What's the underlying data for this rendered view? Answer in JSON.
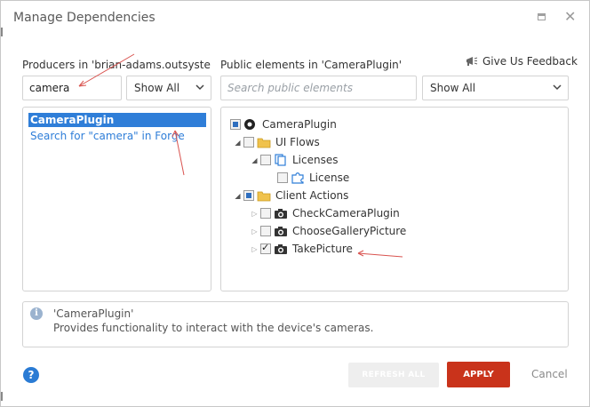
{
  "dialog": {
    "title": "Manage Dependencies",
    "window_controls": [
      "maximize-icon",
      "close-icon"
    ]
  },
  "producers": {
    "label": "Producers in 'brian-adams.outsystem...",
    "search_value": "camera",
    "filter": "Show All",
    "items": [
      {
        "label": "CameraPlugin",
        "selected": true
      },
      {
        "label": "Search for \"camera\" in Forge",
        "link": true
      }
    ]
  },
  "public_elements": {
    "label": "Public elements in 'CameraPlugin'",
    "search_placeholder": "Search public elements",
    "filter": "Show All",
    "feedback_label": "Give Us Feedback",
    "tree": {
      "root": {
        "label": "CameraPlugin",
        "check": "partial",
        "icon": "radio-module-icon"
      },
      "ui_flows": {
        "label": "UI Flows",
        "check": "none",
        "icon": "folder-icon",
        "expanded": true
      },
      "licenses": {
        "label": "Licenses",
        "check": "none",
        "icon": "pages-icon",
        "expanded": true
      },
      "license": {
        "label": "License",
        "check": "none",
        "icon": "puzzle-icon"
      },
      "client_actions": {
        "label": "Client Actions",
        "check": "partial",
        "icon": "folder-icon",
        "expanded": true
      },
      "check_camera": {
        "label": "CheckCameraPlugin",
        "check": "none",
        "icon": "camera-icon",
        "expanded": false
      },
      "choose_gallery": {
        "label": "ChooseGalleryPicture",
        "check": "none",
        "icon": "camera-icon",
        "expanded": false
      },
      "take_picture": {
        "label": "TakePicture",
        "check": "checked",
        "icon": "camera-icon",
        "expanded": false
      }
    }
  },
  "info": {
    "title": "'CameraPlugin'",
    "description": "Provides functionality to interact with the device's cameras."
  },
  "footer": {
    "help": "?",
    "refresh_label": "REFRESH ALL",
    "apply_label": "APPLY",
    "cancel_label": "Cancel"
  },
  "colors": {
    "selection": "#2f7ed8",
    "link": "#2f7ed8",
    "apply": "#c9331b",
    "annotation_arrows": "#d9534f",
    "help": "#2a7bd4"
  }
}
